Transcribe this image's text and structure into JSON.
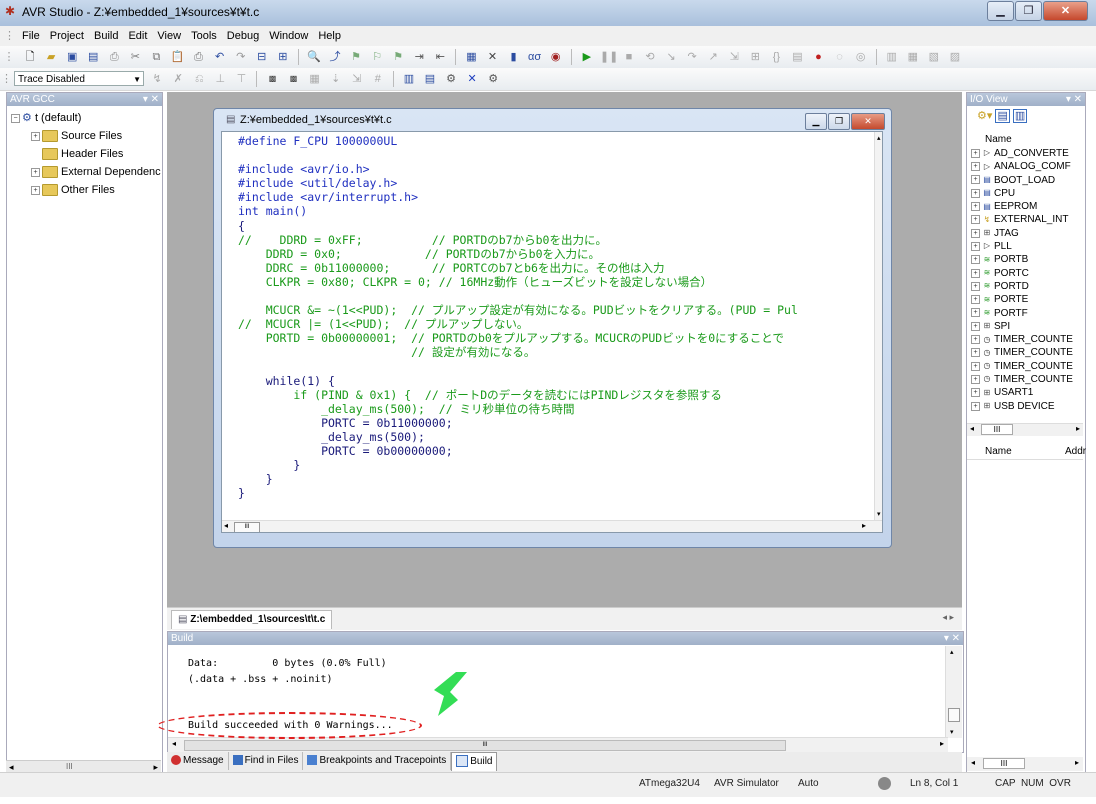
{
  "window": {
    "title": "AVR Studio - Z:¥embedded_1¥sources¥t¥t.c"
  },
  "menu": [
    "File",
    "Project",
    "Build",
    "Edit",
    "View",
    "Tools",
    "Debug",
    "Window",
    "Help"
  ],
  "trace": {
    "selected": "Trace Disabled"
  },
  "left_panel": {
    "title": "AVR GCC",
    "root": "t (default)",
    "items": [
      "Source Files",
      "Header Files",
      "External Dependenc",
      "Other Files"
    ]
  },
  "editor": {
    "title": "Z:¥embedded_1¥sources¥t¥t.c",
    "lines": [
      {
        "t": "#define F_CPU 1000000UL",
        "c": "kw"
      },
      {
        "t": "",
        "c": ""
      },
      {
        "t": "#include <avr/io.h>",
        "c": "kw"
      },
      {
        "t": "#include <util/delay.h>",
        "c": "kw"
      },
      {
        "t": "#include <avr/interrupt.h>",
        "c": "kw"
      },
      {
        "t": "int main()",
        "c": "kw"
      },
      {
        "t": "{",
        "c": ""
      },
      {
        "t": "//    DDRD = 0xFF;          // PORTDのb7からb0を出力に。",
        "c": "cmt"
      },
      {
        "t": "    DDRD = 0x0;            // PORTDのb7からb0を入力に。",
        "c": "cmt"
      },
      {
        "t": "    DDRC = 0b11000000;      // PORTCのb7とb6を出力に。その他は入力",
        "c": "cmt"
      },
      {
        "t": "    CLKPR = 0x80; CLKPR = 0; // 16MHz動作（ヒューズビットを設定しない場合）",
        "c": "cmt"
      },
      {
        "t": "",
        "c": ""
      },
      {
        "t": "    MCUCR &= ~(1<<PUD);  // プルアップ設定が有効になる。PUDビットをクリアする。(PUD = Pul",
        "c": "cmt"
      },
      {
        "t": "//  MCUCR |= (1<<PUD);  // プルアップしない。",
        "c": "cmt"
      },
      {
        "t": "    PORTD = 0b00000001;  // PORTDのb0をプルアップする。MCUCRのPUDビットを0にすることで",
        "c": "cmt"
      },
      {
        "t": "                         // 設定が有効になる。",
        "c": "cmt"
      },
      {
        "t": "",
        "c": ""
      },
      {
        "t": "    while(1) {",
        "c": ""
      },
      {
        "t": "        if (PIND & 0x1) {  // ポートDのデータを読むにはPINDレジスタを参照する",
        "c": "cmt"
      },
      {
        "t": "            _delay_ms(500);  // ミリ秒単位の待ち時間",
        "c": "cmt"
      },
      {
        "t": "            PORTC = 0b11000000;",
        "c": ""
      },
      {
        "t": "            _delay_ms(500);",
        "c": ""
      },
      {
        "t": "            PORTC = 0b00000000;",
        "c": ""
      },
      {
        "t": "        }",
        "c": ""
      },
      {
        "t": "    }",
        "c": ""
      },
      {
        "t": "}",
        "c": ""
      }
    ]
  },
  "doc_tab": "Z:\\embedded_1\\sources\\t\\t.c",
  "build_panel": {
    "title": "Build",
    "lines": [
      "Data:         0 bytes (0.0% Full)",
      "(.data + .bss + .noinit)",
      "",
      "",
      "Build succeeded with 0 Warnings..."
    ]
  },
  "bottom_tabs": [
    "Message",
    "Find in Files",
    "Breakpoints and Tracepoints",
    "Build"
  ],
  "io_view": {
    "title": "I/O View",
    "column": "Name",
    "column2": "Name",
    "column3": "Addr",
    "items": [
      "AD_CONVERTE",
      "ANALOG_COMF",
      "BOOT_LOAD",
      "CPU",
      "EEPROM",
      "EXTERNAL_INT",
      "JTAG",
      "PLL",
      "PORTB",
      "PORTC",
      "PORTD",
      "PORTE",
      "PORTF",
      "SPI",
      "TIMER_COUNTE",
      "TIMER_COUNTE",
      "TIMER_COUNTE",
      "TIMER_COUNTE",
      "USART1",
      "USB DEVICE"
    ],
    "icons": [
      "dac-icon",
      "dac-icon",
      "register-icon",
      "register-icon",
      "register-icon",
      "interrupt-icon",
      "jtag-icon",
      "pll-icon",
      "port-icon",
      "port-icon",
      "port-icon",
      "port-icon",
      "port-icon",
      "spi-icon",
      "timer-icon",
      "timer-icon",
      "timer-icon",
      "timer-icon",
      "usart-icon",
      "usb-icon"
    ]
  },
  "status_bar": {
    "device": "ATmega32U4",
    "platform": "AVR Simulator",
    "mode": "Auto",
    "position": "Ln 8, Col 1",
    "keys": "CAP  NUM  OVR"
  },
  "colors": {
    "comment": "#1a9a1a",
    "keyword": "#2030c0",
    "highlight": "#e02020",
    "arrow": "#33dd55"
  }
}
